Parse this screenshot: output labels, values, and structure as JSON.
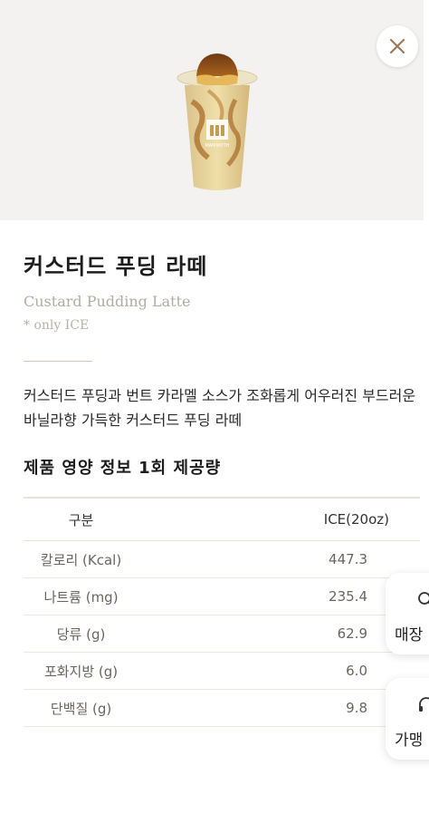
{
  "product": {
    "title": "커스터드 푸딩 라떼",
    "english_name": "Custard Pudding Latte",
    "note": "* only ICE",
    "description": "커스터드 푸딩과 번트 카라멜 소스가 조화롭게 어우러진 부드러운 바닐라향 가득한 커스터드 푸딩 라떼",
    "cup_brand_text": "MAMMOTH"
  },
  "nutrition": {
    "heading": "제품 영양 정보 1회 제공량",
    "columns": [
      "구분",
      "ICE(20oz)"
    ],
    "rows": [
      {
        "label": "칼로리 (Kcal)",
        "value": "447.3"
      },
      {
        "label": "나트륨 (mg)",
        "value": "235.4"
      },
      {
        "label": "당류 (g)",
        "value": "62.9"
      },
      {
        "label": "포화지방 (g)",
        "value": "6.0"
      },
      {
        "label": "단백질 (g)",
        "value": "9.8"
      }
    ]
  },
  "floating": {
    "store_label": "매장",
    "franchise_label": "가맹"
  },
  "icons": {
    "close": "close-icon",
    "store": "search-icon",
    "franchise": "headset-icon"
  },
  "colors": {
    "accent": "#a07a5a",
    "muted_text": "#b3aca5",
    "hero_bg": "#f3f2f0"
  }
}
